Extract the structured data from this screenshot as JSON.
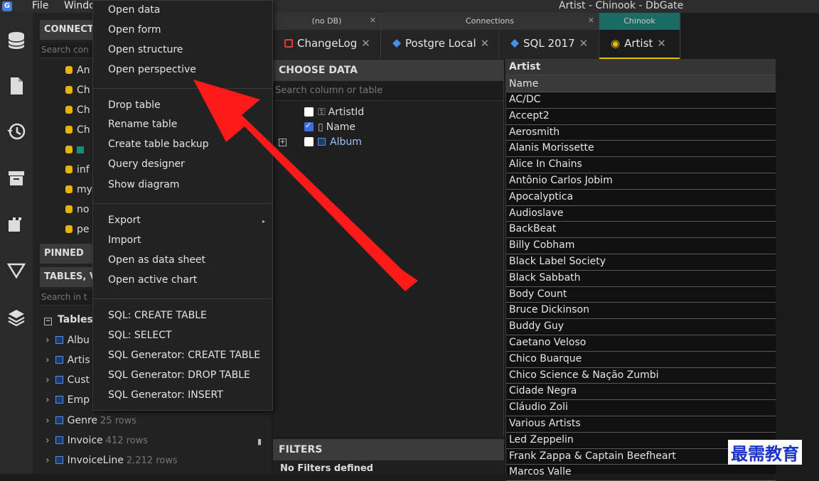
{
  "titlebar": {
    "file_menu": "File",
    "window_menu": "Windo",
    "app_title": "Artist - Chinook - DbGate",
    "logo": "G"
  },
  "iconbar": [
    "database-icon",
    "file-icon",
    "history-icon",
    "archive-icon",
    "plugin-icon",
    "filter-icon",
    "layers-icon"
  ],
  "left": {
    "connections_header": "CONNECT",
    "connections_search": "Search con",
    "conn_items": [
      "An",
      "Ch",
      "Ch",
      "Ch",
      "",
      "inf",
      "my",
      "no",
      "pe"
    ],
    "pinned_header": "PINNED",
    "tables_header": "TABLES, V",
    "tables_search": "Search in t",
    "tables_group": "Tables",
    "tables": [
      {
        "name": "Albu",
        "rows": ""
      },
      {
        "name": "Artis",
        "rows": ""
      },
      {
        "name": "Cust",
        "rows": ""
      },
      {
        "name": "Emp",
        "rows": ""
      },
      {
        "name": "Genre",
        "rows": "25 rows"
      },
      {
        "name": "Invoice",
        "rows": "412 rows"
      },
      {
        "name": "InvoiceLine",
        "rows": "2,212 rows"
      }
    ]
  },
  "context_menu": {
    "items": [
      "Open data",
      "Open form",
      "Open structure",
      "Open perspective",
      "Drop table",
      "Rename table",
      "Create table backup",
      "Query designer",
      "Show diagram",
      "Export",
      "Import",
      "Open as data sheet",
      "Open active chart",
      "SQL: CREATE TABLE",
      "SQL: SELECT",
      "SQL Generator: CREATE TABLE",
      "SQL Generator: DROP TABLE",
      "SQL Generator: INSERT"
    ],
    "submenu_arrow": "▸"
  },
  "tabs": {
    "groups": [
      {
        "header": "(no DB)",
        "tab": "ChangeLog",
        "color": "#e23b3b"
      },
      {
        "header": "Connections",
        "tab": "Postgre Local",
        "color": "#4a8df0"
      },
      {
        "header": "",
        "tab": "SQL 2017",
        "color": "#4a8df0"
      },
      {
        "header": "Chinook",
        "tab": "Artist",
        "color": "#e0c000"
      }
    ],
    "close": "✕"
  },
  "choose_data": {
    "header": "CHOOSE DATA",
    "search_placeholder": "Search column or table",
    "columns": [
      {
        "name": "ArtistId",
        "checked": false
      },
      {
        "name": "Name",
        "checked": true
      },
      {
        "name": "Album",
        "checked": false
      }
    ],
    "expander": "+"
  },
  "filters": {
    "header": "FILTERS",
    "empty": "No Filters defined"
  },
  "grid": {
    "title": "Artist",
    "column": "Name",
    "rows": [
      "AC/DC",
      "Accept2",
      "Aerosmith",
      "Alanis Morissette",
      "Alice In Chains",
      "Antônio Carlos Jobim",
      "Apocalyptica",
      "Audioslave",
      "BackBeat",
      "Billy Cobham",
      "Black Label Society",
      "Black Sabbath",
      "Body Count",
      "Bruce Dickinson",
      "Buddy Guy",
      "Caetano Veloso",
      "Chico Buarque",
      "Chico Science & Nação Zumbi",
      "Cidade Negra",
      "Cláudio Zoli",
      "Various Artists",
      "Led Zeppelin",
      "Frank Zappa & Captain Beefheart",
      "Marcos Valle"
    ]
  },
  "watermark": "最需教育",
  "colors": {
    "arrow": "#ff1a1a",
    "accent": "#3b6fe0",
    "db": "#e6b400"
  }
}
